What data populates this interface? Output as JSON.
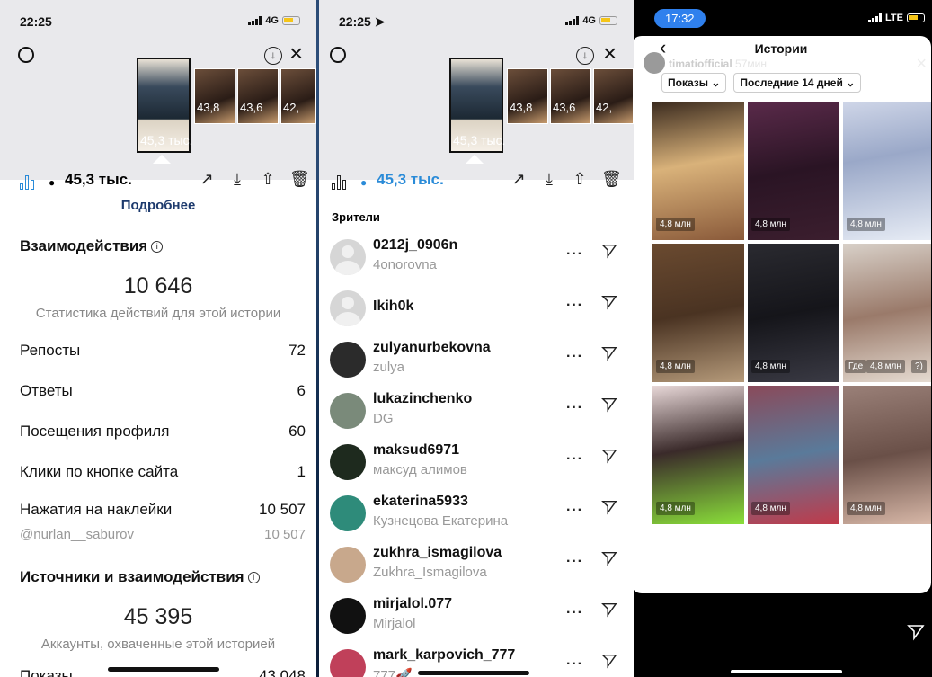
{
  "panel1": {
    "time": "22:25",
    "network": "4G",
    "story_thumbs": [
      {
        "views": "45,3 тыс."
      },
      {
        "views": "43,8"
      },
      {
        "views": "43,6"
      },
      {
        "views": "42,"
      }
    ],
    "views_count": "45,3 тыс.",
    "more_link": "Подробнее",
    "interactions_title": "Взаимодействия",
    "interactions_total": "10 646",
    "interactions_caption": "Статистика действий для этой истории",
    "metrics": [
      {
        "label": "Репосты",
        "value": "72"
      },
      {
        "label": "Ответы",
        "value": "6"
      },
      {
        "label": "Посещения профиля",
        "value": "60"
      },
      {
        "label": "Клики по кнопке сайта",
        "value": "1"
      },
      {
        "label": "Нажатия на наклейки",
        "value": "10 507"
      }
    ],
    "sticker_sub": {
      "label": "@nurlan__saburov",
      "value": "10 507"
    },
    "sources_title": "Источники и взаимодействия",
    "reach_total": "45 395",
    "reach_caption": "Аккаунты, охваченные этой историей",
    "cut_label": "Показы",
    "cut_value": "43 048"
  },
  "panel2": {
    "time": "22:25",
    "network": "4G",
    "story_thumbs": [
      {
        "views": "45,3 тыс."
      },
      {
        "views": "43,8"
      },
      {
        "views": "43,6"
      },
      {
        "views": "42,"
      }
    ],
    "views_count": "45,3 тыс.",
    "viewers_title": "Зрители",
    "viewers": [
      {
        "username": "0212j_0906n",
        "name": "4onorovna",
        "avatar": "blank"
      },
      {
        "username": "Ikih0k",
        "name": "",
        "avatar": "blank"
      },
      {
        "username": "zulyanurbekovna",
        "name": "zulya",
        "avatar": "#2b2b2b"
      },
      {
        "username": "lukazinchenko",
        "name": "DG",
        "avatar": "#7a8a7a"
      },
      {
        "username": "maksud6971",
        "name": "максуд алимов",
        "avatar": "#1e2a1e"
      },
      {
        "username": "ekaterina5933",
        "name": "Кузнецова Екатерина",
        "avatar": "#2e8b7a"
      },
      {
        "username": "zukhra_ismagilova",
        "name": "Zukhra_Ismagilova",
        "avatar": "#c8a88c"
      },
      {
        "username": "mirjalol.077",
        "name": "Mirjalol",
        "avatar": "#111111"
      },
      {
        "username": "mark_karpovich_777",
        "name": "777🚀",
        "avatar": "#c0405a"
      }
    ]
  },
  "panel3": {
    "time": "17:32",
    "network": "LTE",
    "title": "Истории",
    "account": "timatiofficial",
    "account_age": "57мин",
    "filter_1": "Показы",
    "filter_2": "Последние 14 дней",
    "stories": [
      {
        "count": "4,8 млн",
        "bg": "linear-gradient(170deg,#3a2a1e,#d9b27a 45%,#8a5a3a)"
      },
      {
        "count": "4,8 млн",
        "bg": "linear-gradient(170deg,#5a2a4a,#2a1424 50%,#3b1e2e)"
      },
      {
        "count": "4,8 млн",
        "bg": "linear-gradient(170deg,#cfd6e8,#9aa8c8 40%,#e7ecf5)"
      },
      {
        "count": "4,8 млн",
        "bg": "linear-gradient(170deg,#6a4a30,#4a3322 50%,#b59a7a)"
      },
      {
        "count": "4,8 млн",
        "bg": "linear-gradient(170deg,#2a2a30,#15151a 50%,#3a3a44)"
      },
      {
        "count": "4,8 млн",
        "bg": "linear-gradient(170deg,#d8d0c8,#9a7a6a 50%,#e6dcd2)"
      },
      {
        "count": "4,8 млн",
        "bg": "linear-gradient(170deg,#e8d8d8,#3a2a2a 45%,#8adf3a)"
      },
      {
        "count": "4,8 млн",
        "bg": "linear-gradient(170deg,#8a4a5a,#5a7a9a 50%,#c03a4a)"
      },
      {
        "count": "4,8 млн",
        "bg": "linear-gradient(170deg,#9a8078,#6a5048 50%,#d8b8a8)"
      }
    ],
    "extra_badges": [
      "Где",
      "?)"
    ]
  }
}
